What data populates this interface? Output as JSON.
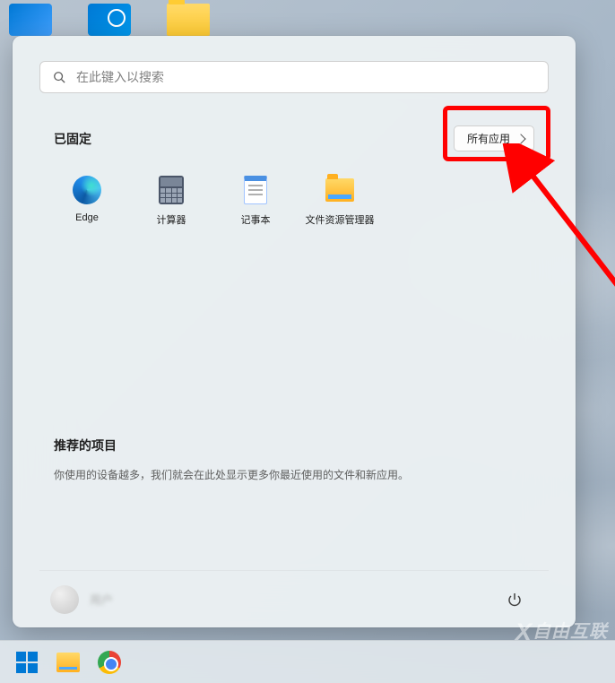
{
  "search": {
    "placeholder": "在此键入以搜索"
  },
  "pinned": {
    "title": "已固定",
    "all_apps_label": "所有应用",
    "items": [
      {
        "label": "Edge",
        "icon": "edge"
      },
      {
        "label": "计算器",
        "icon": "calculator"
      },
      {
        "label": "记事本",
        "icon": "notepad"
      },
      {
        "label": "文件资源管理器",
        "icon": "file-explorer"
      }
    ]
  },
  "recommended": {
    "title": "推荐的项目",
    "empty_text": "你使用的设备越多，我们就会在此处显示更多你最近使用的文件和新应用。"
  },
  "user": {
    "name": "用户"
  },
  "watermark": "自由互联",
  "annotation": {
    "highlight_target": "all-apps-button"
  }
}
